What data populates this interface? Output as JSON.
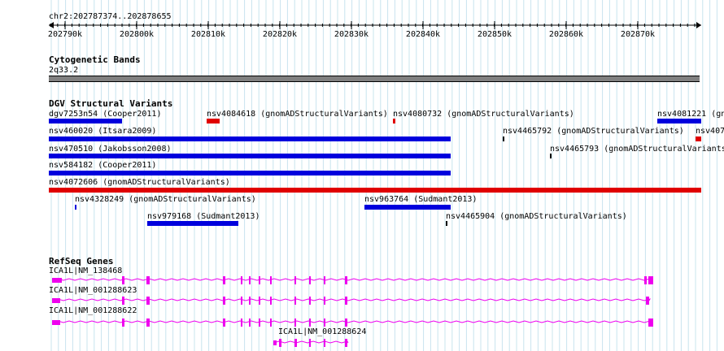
{
  "locus": "chr2:202787374..202878655",
  "ruler_ticks": [
    "202790k",
    "202800k",
    "202810k",
    "202820k",
    "202830k",
    "202840k",
    "202850k",
    "202860k",
    "202870k"
  ],
  "colors": {
    "grid": "#c8e4ee",
    "dgv_blue": "#0000dd",
    "dgv_red": "#e00000",
    "gene": "#ee00ee",
    "band": "#808080"
  },
  "cytoband": {
    "title": "Cytogenetic Bands",
    "band_label": "2q33.2"
  },
  "dgv": {
    "title": "DGV Structural Variants",
    "labels": {
      "dgv7253n54": "dgv7253n54 (Cooper2011)",
      "nsv4084618": "nsv4084618 (gnomADStructuralVariants)",
      "nsv4080732": "nsv4080732 (gnomADStructuralVariants)",
      "nsv4081221": "nsv4081221 (gn",
      "nsv460020": "nsv460020 (Itsara2009)",
      "nsv4465792": "nsv4465792 (gnomADStructuralVariants)",
      "nsv407": "nsv407",
      "nsv470510": "nsv470510 (Jakobsson2008)",
      "nsv4465793": "nsv4465793 (gnomADStructuralVariants",
      "nsv584182": "nsv584182 (Cooper2011)",
      "nsv4072606": "nsv4072606 (gnomADStructuralVariants)",
      "nsv4328249": "nsv4328249 (gnomADStructuralVariants)",
      "nsv963764": "nsv963764 (Sudmant2013)",
      "nsv979168": "nsv979168 (Sudmant2013)",
      "nsv4465904": "nsv4465904 (gnomADStructuralVariants)"
    }
  },
  "refseq": {
    "title": "RefSeq Genes",
    "genes": [
      "ICA1L|NM_138468",
      "ICA1L|NM_001288623",
      "ICA1L|NM_001288622",
      "ICA1L|NM_001288624"
    ]
  }
}
